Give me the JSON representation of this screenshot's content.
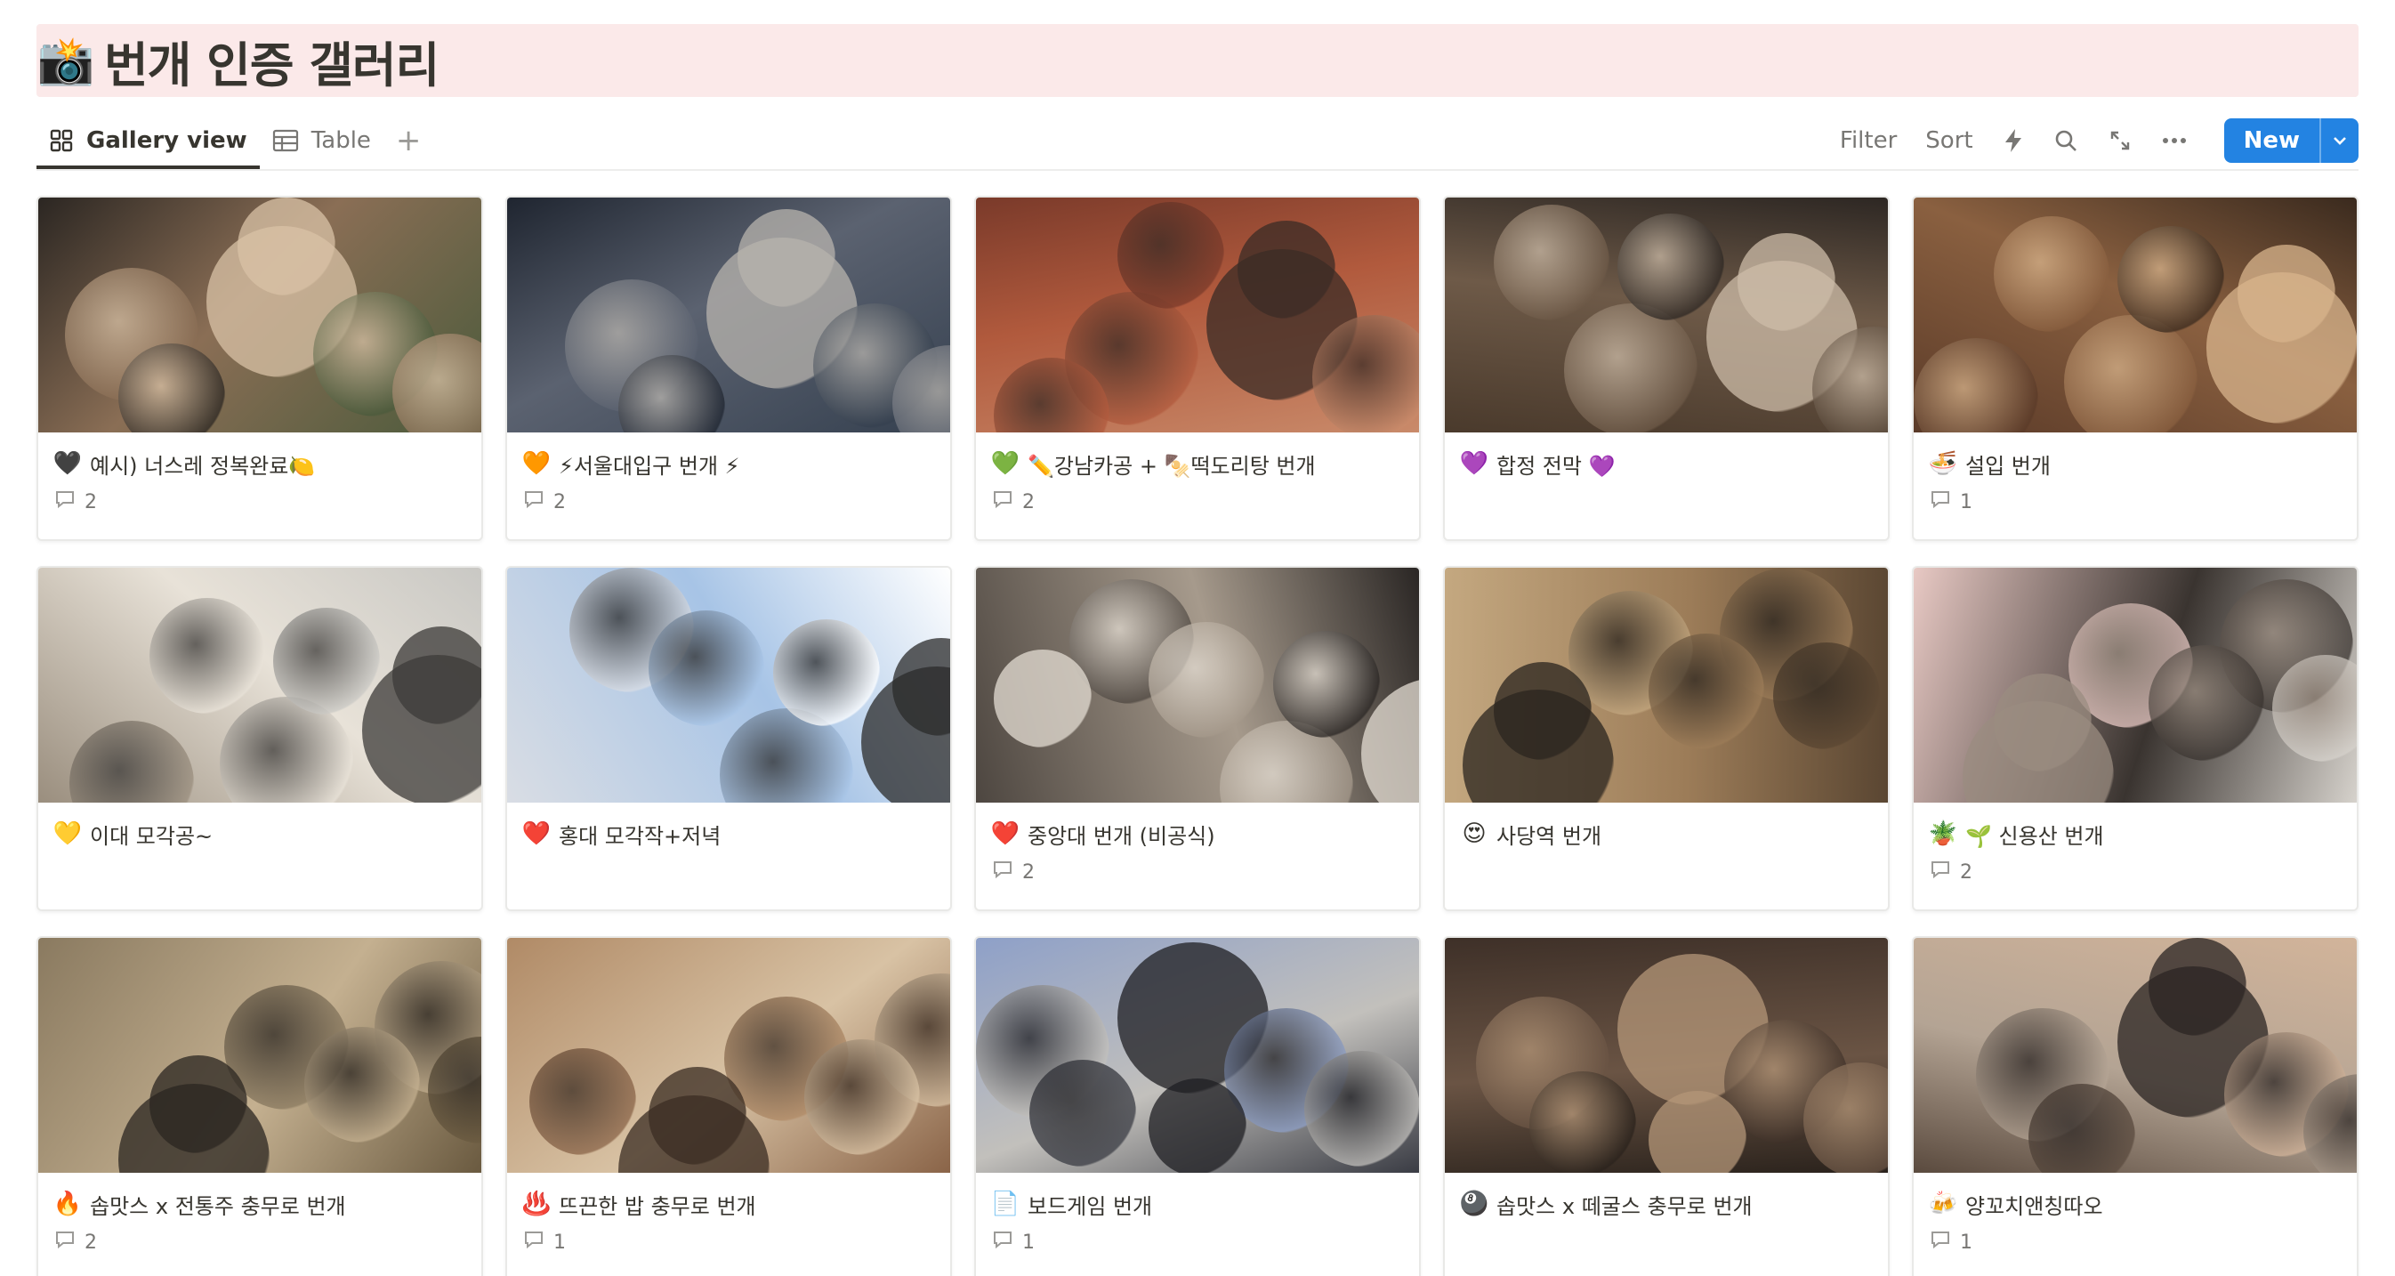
{
  "page": {
    "title_emoji": "📸",
    "title": "번개 인증 갤러리"
  },
  "views": {
    "tabs": [
      {
        "label": "Gallery view",
        "active": true
      },
      {
        "label": "Table",
        "active": false
      }
    ],
    "add_symbol": "+"
  },
  "toolbar": {
    "filter_label": "Filter",
    "sort_label": "Sort",
    "new_label": "New"
  },
  "cards": [
    {
      "emoji": "🖤",
      "title": "예시) 너스레 정복완료🍋",
      "comments": "2",
      "photo": [
        "#2b2622",
        "#8a6e55",
        "#d9c2a6",
        "#4a5a3b"
      ]
    },
    {
      "emoji": "🧡",
      "title": "⚡서울대입구 번개 ⚡",
      "comments": "2",
      "photo": [
        "#1f2530",
        "#5b6270",
        "#b7b3ad",
        "#35404f"
      ]
    },
    {
      "emoji": "💚",
      "title": "✏️강남카공 + 🍢떡도리탕 번개",
      "comments": "2",
      "photo": [
        "#7a3a2a",
        "#b15a3d",
        "#3a2b25",
        "#c98a6a"
      ]
    },
    {
      "emoji": "💜",
      "title": "합정 전막 💜",
      "comments": "",
      "photo": [
        "#2d2723",
        "#6e5a48",
        "#cdbca8",
        "#4a3a2c"
      ]
    },
    {
      "emoji": "🍜",
      "title": "설입 번개",
      "comments": "1",
      "photo": [
        "#3a2a1e",
        "#8a6040",
        "#d8b48c",
        "#5a3a28"
      ]
    },
    {
      "emoji": "💛",
      "title": "이대 모각공~",
      "comments": "",
      "photo": [
        "#c9c8c4",
        "#e8e2d8",
        "#3c3a38",
        "#9a8e7e"
      ]
    },
    {
      "emoji": "❤️",
      "title": "홍대 모각작+저녁",
      "comments": "",
      "photo": [
        "#ffffff",
        "#a7c4e6",
        "#2a2a2a",
        "#d9dde4"
      ]
    },
    {
      "emoji": "❤️",
      "title": "중앙대 번개 (비공식)",
      "comments": "2",
      "photo": [
        "#2a2624",
        "#a69a8c",
        "#e4ddd3",
        "#4d4640"
      ]
    },
    {
      "emoji": "😍",
      "title": "사당역 번개",
      "comments": "",
      "photo": [
        "#5a4632",
        "#9c7c58",
        "#2a241e",
        "#c4a880"
      ]
    },
    {
      "emoji": "🪴",
      "title": "🌱 신용산 번개",
      "comments": "2",
      "photo": [
        "#d6d2cc",
        "#3a3430",
        "#9a8c80",
        "#e8c9c4"
      ]
    },
    {
      "emoji": "🔥",
      "title": "솝맛스 x 전통주 충무로 번개",
      "comments": "2",
      "photo": [
        "#6a5a40",
        "#c4b090",
        "#2a2520",
        "#8a7a60"
      ]
    },
    {
      "emoji": "♨️",
      "title": "뜨끈한 밥 충무로 번개",
      "comments": "1",
      "photo": [
        "#8a6448",
        "#d8c2a4",
        "#3a2c22",
        "#b08a66"
      ]
    },
    {
      "emoji": "📄",
      "title": "보드게임 번개",
      "comments": "1",
      "photo": [
        "#3a3c44",
        "#c2c0bc",
        "#1e1e22",
        "#8ea0c8"
      ]
    },
    {
      "emoji": "🎱",
      "title": "솝맛스 x 떼굴스 충무로 번개",
      "comments": "",
      "photo": [
        "#2a221c",
        "#6a5444",
        "#b49678",
        "#3e3028"
      ]
    },
    {
      "emoji": "🍻",
      "title": "양꼬치앤칭따오",
      "comments": "1",
      "photo": [
        "#5a4a3e",
        "#b4a494",
        "#2a2422",
        "#d2b49a"
      ]
    }
  ]
}
